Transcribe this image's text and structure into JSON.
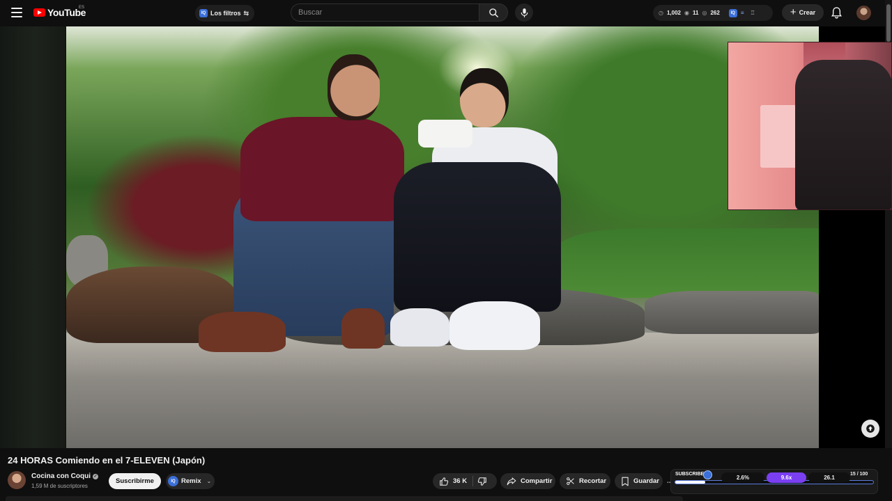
{
  "header": {
    "logo_text": "YouTube",
    "country_code": "ES",
    "filters_label": "Los filtros",
    "filters_badge": "IQ",
    "search_placeholder": "Buscar",
    "stats": {
      "time": "1,002",
      "views": "11",
      "watched": "262",
      "badge": "IQ"
    },
    "create_label": "Crear"
  },
  "video": {
    "title": "24 HORAS Comiendo en el 7-ELEVEN (Japón)"
  },
  "channel": {
    "name": "Cocina con Coqui",
    "subscribers": "1,59 M de suscriptores",
    "verified_icon": "verified-icon"
  },
  "actions": {
    "subscribe": "Suscribirme",
    "remix": "Remix",
    "remix_badge": "IQ",
    "likes": "36 K",
    "share": "Compartir",
    "clip": "Recortar",
    "save": "Guardar",
    "more": "..."
  },
  "panel": {
    "label": "SUBSCRIBERS",
    "metric_1": "2.6%",
    "metric_2": "9.6x",
    "metric_3": "26.1",
    "count": "15  / 100",
    "progress_fraction": 0.15
  },
  "colors": {
    "brand_red": "#ff0000",
    "accent_blue": "#3b6fd8",
    "accent_purple": "#7b3ff2",
    "background": "#0f0f0f"
  },
  "icons": [
    "menu-icon",
    "youtube-logo-icon",
    "tune-icon",
    "search-icon",
    "mic-icon",
    "clock-icon",
    "eye-icon",
    "create-plus-icon",
    "bell-icon",
    "like-icon",
    "dislike-icon",
    "share-icon",
    "scissors-icon",
    "bookmark-icon"
  ]
}
